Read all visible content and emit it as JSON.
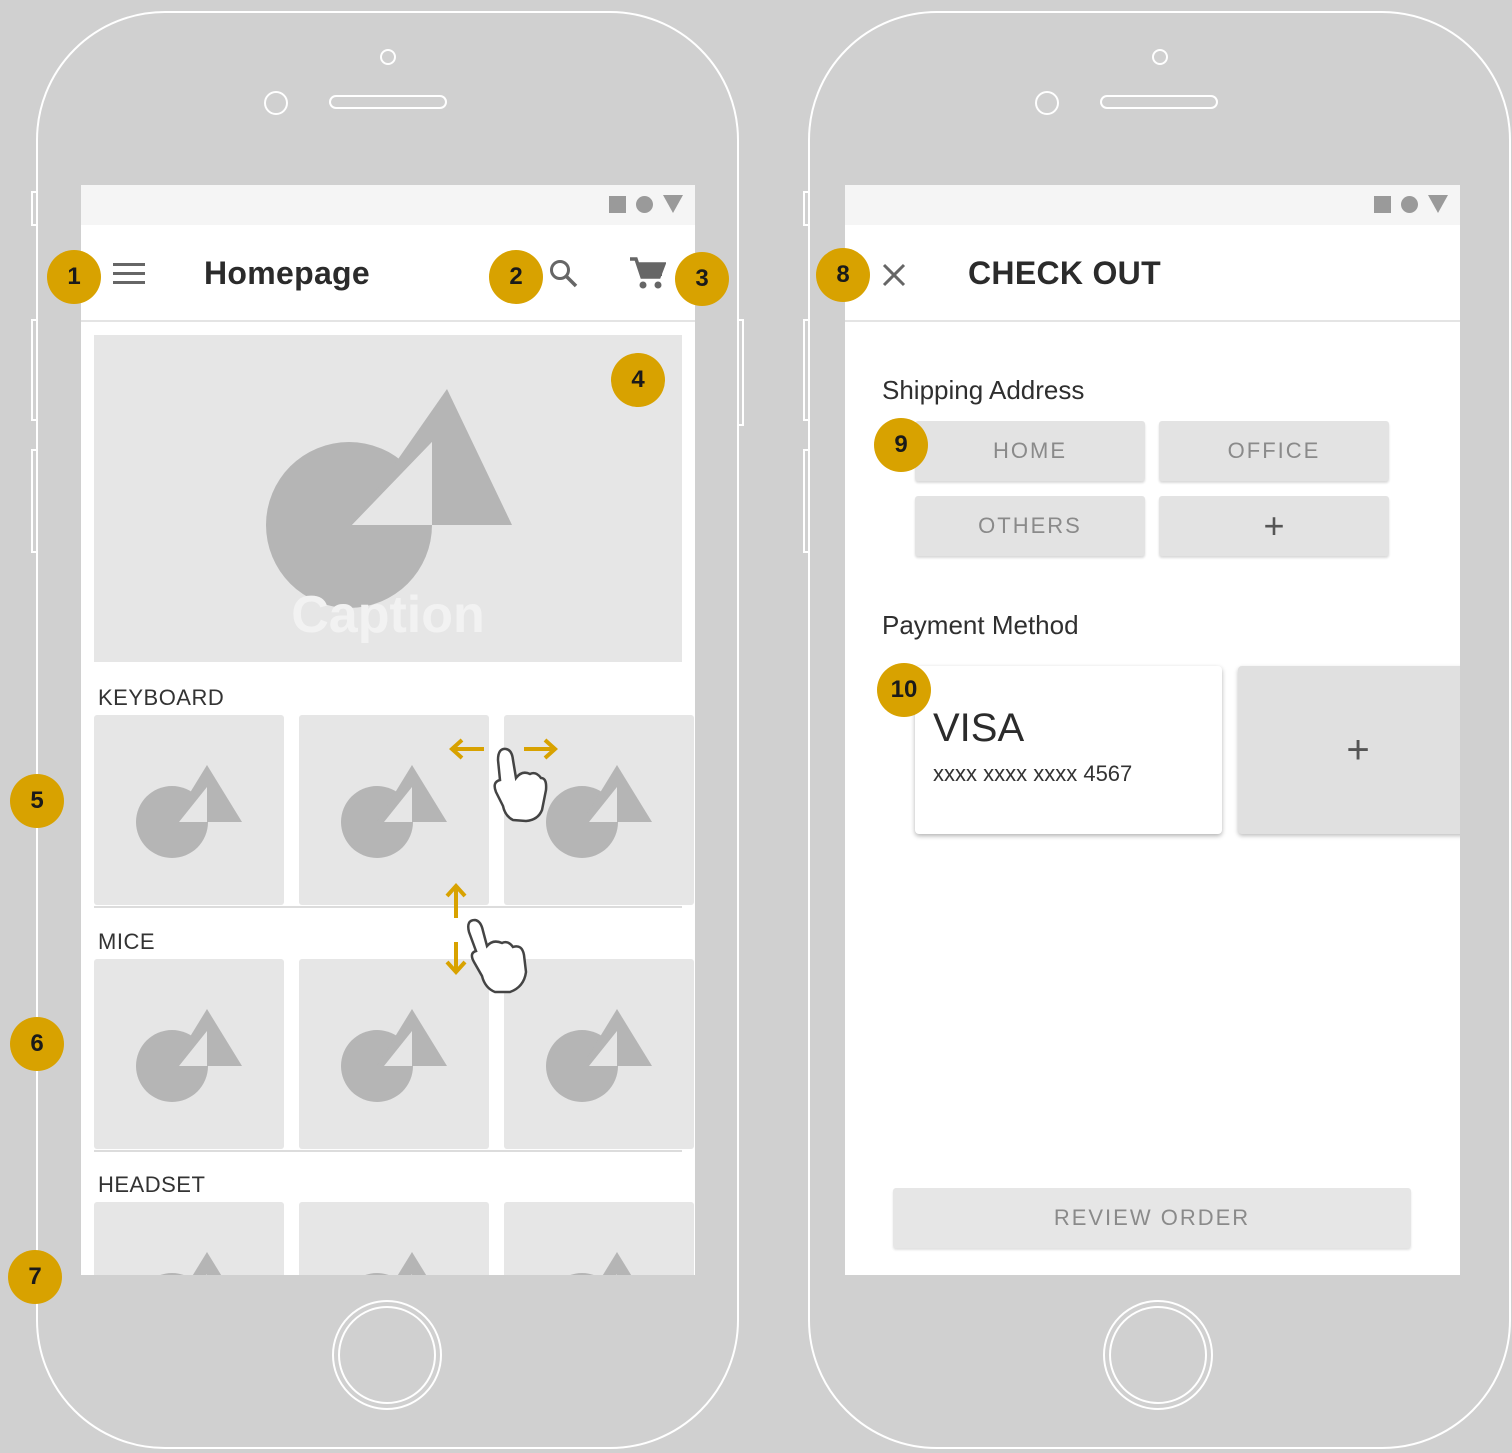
{
  "colors": {
    "accent": "#d8a200",
    "background": "#d0d0d0",
    "placeholder": "#e6e6e6",
    "placeholder_shape": "#b5b5b5"
  },
  "homepage": {
    "title": "Homepage",
    "menu_icon": "hamburger-menu-icon",
    "search_icon": "search-icon",
    "cart_icon": "shopping-cart-icon",
    "banner": {
      "caption": "Caption"
    },
    "categories": [
      {
        "label": "KEYBOARD"
      },
      {
        "label": "MICE"
      },
      {
        "label": "HEADSET"
      }
    ]
  },
  "checkout": {
    "title": "CHECK OUT",
    "close_icon": "close-icon",
    "shipping": {
      "title": "Shipping Address",
      "options": [
        "HOME",
        "OFFICE",
        "OTHERS",
        "+"
      ]
    },
    "payment": {
      "title": "Payment Method",
      "card_brand": "VISA",
      "card_number": "xxxx xxxx xxxx 4567",
      "add_label": "+"
    },
    "review_button": "REVIEW ORDER"
  },
  "badges": [
    "1",
    "2",
    "3",
    "4",
    "5",
    "6",
    "7",
    "8",
    "9",
    "10"
  ]
}
